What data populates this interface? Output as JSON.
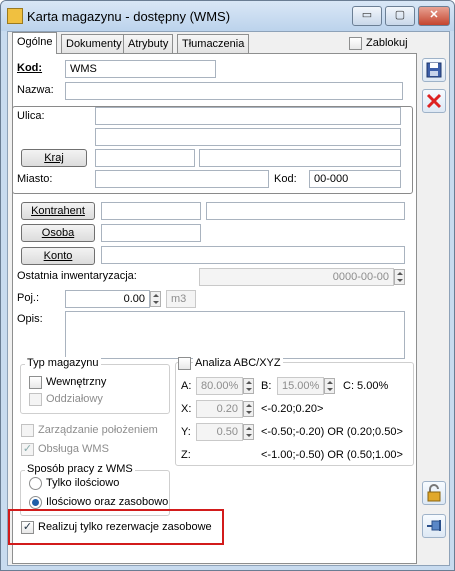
{
  "window": {
    "title": "Karta magazynu - dostępny (WMS)",
    "minimize": "▭",
    "maximize": "▢",
    "close": "✕"
  },
  "tabs": [
    "Ogólne",
    "Dokumenty",
    "Atrybuty",
    "Tłumaczenia"
  ],
  "header": {
    "lock_label": "Zablokuj",
    "lock_checked": false
  },
  "form": {
    "kod_label": "Kod:",
    "kod_value": "WMS",
    "nazwa_label": "Nazwa:",
    "nazwa_value": "",
    "ulica_label": "Ulica:",
    "kraj_button": "Kraj",
    "miasto_label": "Miasto:",
    "kod_pocztowy_label": "Kod:",
    "kod_pocztowy_value": "00-000",
    "kontrahent_button": "Kontrahent",
    "osoba_button": "Osoba",
    "konto_button": "Konto",
    "inwentaryzacja_label": "Ostatnia inwentaryzacja:",
    "inwentaryzacja_value": "0000-00-00",
    "poj_label": "Poj.:",
    "poj_value": "0.00",
    "poj_unit": "m3",
    "opis_label": "Opis:",
    "opis_value": ""
  },
  "typ_magazynu": {
    "title": "Typ magazynu",
    "wewnetrzny": "Wewnętrzny",
    "oddzialowy": "Oddziałowy"
  },
  "abc": {
    "title": "Analiza ABC/XYZ",
    "a_label": "A:",
    "a_value": "80.00%",
    "b_label": "B:",
    "b_value": "15.00%",
    "c_text": "C: 5.00%",
    "x_label": "X:",
    "x_value": "0.20",
    "x_range": "<-0.20;0.20>",
    "y_label": "Y:",
    "y_value": "0.50",
    "y_range": "<-0.50;-0.20) OR (0.20;0.50>",
    "z_label": "Z:",
    "z_range": "<-1.00;-0.50) OR (0.50;1.00>"
  },
  "checks": {
    "zarzadzanie": "Zarządzanie położeniem",
    "obsluga": "Obsługa WMS"
  },
  "sposob": {
    "title": "Sposób pracy z WMS",
    "opt1": "Tylko ilościowo",
    "opt2": "Ilościowo oraz zasobowo"
  },
  "rezerwacje": {
    "label": "Realizuj tylko rezerwacje zasobowe",
    "checked": true
  },
  "colors": {
    "highlight": "#d21b1b",
    "window_frame": "#c8dbef"
  }
}
